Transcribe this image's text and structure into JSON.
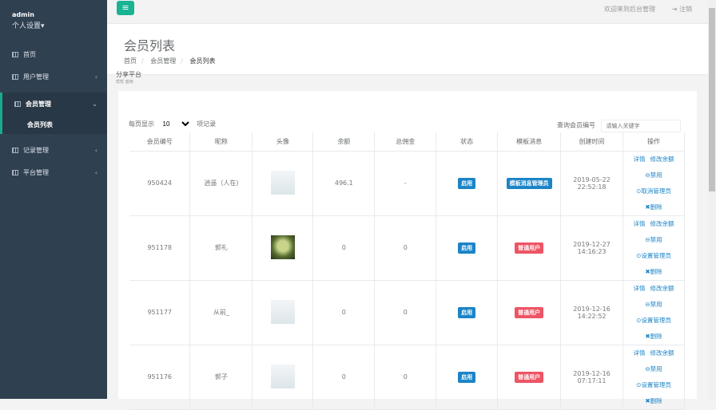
{
  "sidebar": {
    "user": "admin",
    "settings": "个人设置",
    "items": [
      {
        "label": "首页"
      },
      {
        "label": "用户管理"
      },
      {
        "label": "会员管理",
        "sub": [
          "会员列表"
        ]
      },
      {
        "label": "记录管理"
      },
      {
        "label": "平台管理"
      }
    ]
  },
  "topbar": {
    "welcome": "欢迎来到后台管理",
    "logout": "注销"
  },
  "heading": {
    "title": "会员列表",
    "breadcrumb": [
      "首页",
      "会员管理",
      "会员列表"
    ],
    "overlay": "分享平台",
    "overlay_small": "帮帮 盛雨"
  },
  "table_controls": {
    "show_prefix": "每页显示",
    "page_size": "10",
    "show_suffix": "项记录",
    "search_label": "查询会员编号",
    "search_placeholder": "请输入关键字"
  },
  "columns": [
    "会员编号",
    "昵称",
    "头像",
    "余额",
    "总佣金",
    "状态",
    "模板消息",
    "创建时间",
    "操作"
  ],
  "rows": [
    {
      "id": "950424",
      "nick": "逍遥（人在)",
      "avatar": "placeholder",
      "balance": "496.1",
      "commission": "-",
      "status": "启用",
      "role": "模板消息管理员",
      "role_color": "#1c84c6",
      "date": "2019-05-22",
      "time": "22:52:18",
      "ops": [
        "详情",
        "修改余额",
        "禁用",
        "取消管理员",
        "删除"
      ]
    },
    {
      "id": "951178",
      "nick": "郭礼",
      "avatar": "photo",
      "balance": "0",
      "commission": "0",
      "status": "启用",
      "role": "普通用户",
      "role_color": "#ed5565",
      "date": "2019-12-27",
      "time": "14:16:23",
      "ops": [
        "详情",
        "修改余额",
        "禁用",
        "设置管理员",
        "删除"
      ]
    },
    {
      "id": "951177",
      "nick": "从前_",
      "avatar": "placeholder",
      "balance": "0",
      "commission": "0",
      "status": "启用",
      "role": "普通用户",
      "role_color": "#ed5565",
      "date": "2019-12-16",
      "time": "14:22:52",
      "ops": [
        "详情",
        "修改余额",
        "禁用",
        "设置管理员",
        "删除"
      ]
    },
    {
      "id": "951176",
      "nick": "郭子",
      "avatar": "placeholder",
      "balance": "0",
      "commission": "0",
      "status": "启用",
      "role": "普通用户",
      "role_color": "#ed5565",
      "date": "2019-12-16",
      "time": "07:17:11",
      "ops": [
        "详情",
        "修改余额",
        "禁用",
        "设置管理员",
        "删除"
      ]
    }
  ]
}
